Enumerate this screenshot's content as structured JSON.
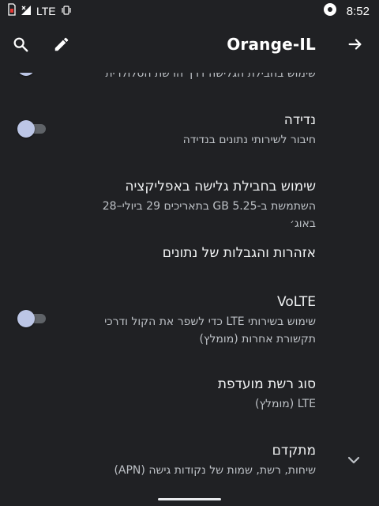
{
  "status_bar": {
    "network": "LTE",
    "time": "8:52",
    "icons": [
      "sim-card-icon",
      "signal-icon",
      "vibrate-icon",
      "media-icon"
    ]
  },
  "app_bar": {
    "title": "Orange-IL",
    "icons": [
      "back-arrow-icon",
      "edit-icon",
      "search-icon"
    ]
  },
  "settings": {
    "mobile_data_summary": "שימוש בחבילת הגלישה דרך הרשת הסלולרית",
    "roaming": {
      "title": "נדידה",
      "summary": "חיבור לשירותי נתונים בנדידה",
      "checked": false
    },
    "app_data_usage": {
      "title": "שימוש בחבילת גלישה באפליקציה",
      "summary": "השתמשת ב-5.25 GB בתאריכים 29 ביולי–28 באוג׳"
    },
    "data_warning": {
      "title": "אזהרות והגבלות של נתונים"
    },
    "volte": {
      "title": "VoLTE",
      "summary": "שימוש בשירותי LTE כדי לשפר את הקול ודרכי תקשורת אחרות (מומלץ)",
      "checked": false
    },
    "network_type": {
      "title": "סוג רשת מועדפת",
      "summary": "LTE (מומלץ)"
    },
    "advanced": {
      "title": "מתקדם",
      "summary": "שיחות, רשת, שמות של נקודות גישה (APN)"
    }
  }
}
